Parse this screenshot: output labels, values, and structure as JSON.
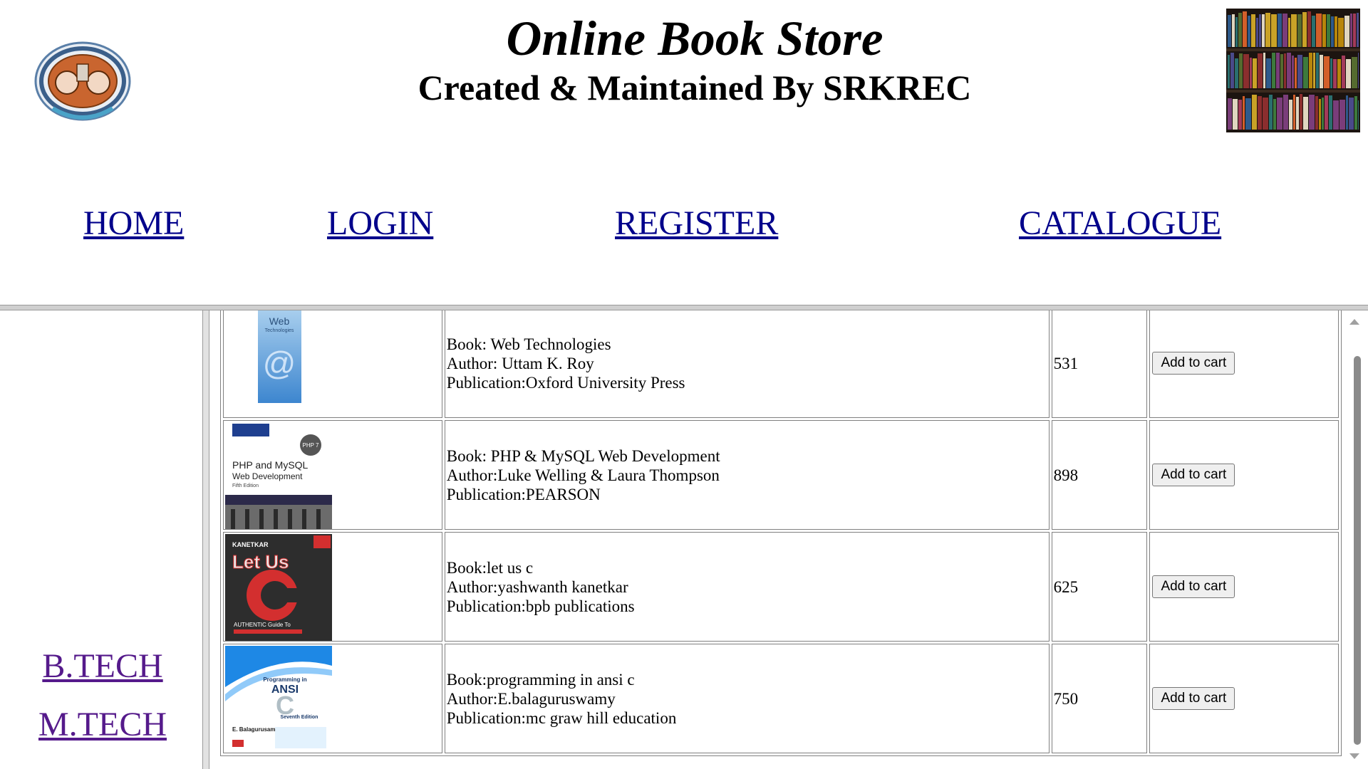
{
  "header": {
    "title": "Online Book Store",
    "subtitle": "Created & Maintained By SRKREC"
  },
  "nav": {
    "home": "HOME",
    "login": "LOGIN",
    "register": "REGISTER",
    "catalogue": "CATALOGUE"
  },
  "sidebar": {
    "btech": "B.TECH",
    "mtech": "M.TECH"
  },
  "books": [
    {
      "book": "Book: Web Technologies",
      "author": "Author: Uttam K. Roy",
      "publication": "Publication:Oxford University Press",
      "price": "531",
      "button": "Add to cart",
      "cover_text": [
        "Web",
        "Technologies"
      ]
    },
    {
      "book": "Book: PHP & MySQL Web Development",
      "author": "Author:Luke Welling & Laura Thompson",
      "publication": "Publication:PEARSON",
      "price": "898",
      "button": "Add to cart",
      "cover_text": [
        "PHP and MySQL",
        "Web Development",
        "Fifth Edition",
        "PHP 7"
      ]
    },
    {
      "book": "Book:let us c",
      "author": "Author:yashwanth kanetkar",
      "publication": "Publication:bpb publications",
      "price": "625",
      "button": "Add to cart",
      "cover_text": [
        "KANETKAR",
        "Let Us",
        "C"
      ]
    },
    {
      "book": "Book:programming in ansi c",
      "author": "Author:E.balaguruswamy",
      "publication": "Publication:mc graw hill education",
      "price": "750",
      "button": "Add to cart",
      "cover_text": [
        "Programming in",
        "ANSI",
        "C",
        "Seventh Edition",
        "E. Balagurusamy"
      ]
    }
  ],
  "colors": {
    "nav_link": "#00008b",
    "visited_link": "#551a8b",
    "frame_border": "#cfcfcf"
  }
}
